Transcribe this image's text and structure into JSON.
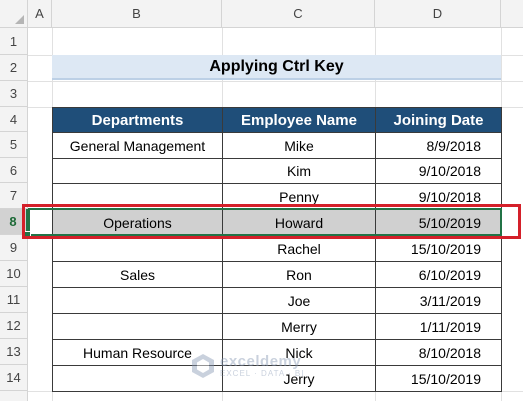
{
  "sheet": {
    "columns": [
      "A",
      "B",
      "C",
      "D"
    ],
    "rows": [
      "1",
      "2",
      "3",
      "4",
      "5",
      "6",
      "7",
      "8",
      "9",
      "10",
      "11",
      "12",
      "13",
      "14"
    ],
    "selected_row": "8"
  },
  "title": "Applying Ctrl Key",
  "table": {
    "headers": [
      "Departments",
      "Employee Name",
      "Joining Date"
    ],
    "rows": [
      {
        "department": "General Management",
        "name": "Mike",
        "date": "8/9/2018"
      },
      {
        "department": "",
        "name": "Kim",
        "date": "9/10/2018"
      },
      {
        "department": "",
        "name": "Penny",
        "date": "9/10/2018"
      },
      {
        "department": "Operations",
        "name": "Howard",
        "date": "5/10/2019"
      },
      {
        "department": "",
        "name": "Rachel",
        "date": "15/10/2019"
      },
      {
        "department": "Sales",
        "name": "Ron",
        "date": "6/10/2019"
      },
      {
        "department": "",
        "name": "Joe",
        "date": "3/11/2019"
      },
      {
        "department": "",
        "name": "Merry",
        "date": "1/11/2019"
      },
      {
        "department": "Human Resource",
        "name": "Nick",
        "date": "8/10/2018"
      },
      {
        "department": "",
        "name": "Jerry",
        "date": "15/10/2019"
      }
    ]
  },
  "watermark": {
    "name": "exceldemy",
    "tagline": "EXCEL · DATA · BI",
    "icon": "exceldemy-logo-icon"
  },
  "colors": {
    "header_fill": "#1f4e79",
    "title_fill": "#dde8f4",
    "highlight_fill": "#d0d0d0",
    "selection_outline": "#d4202a",
    "active_cell": "#217346"
  }
}
